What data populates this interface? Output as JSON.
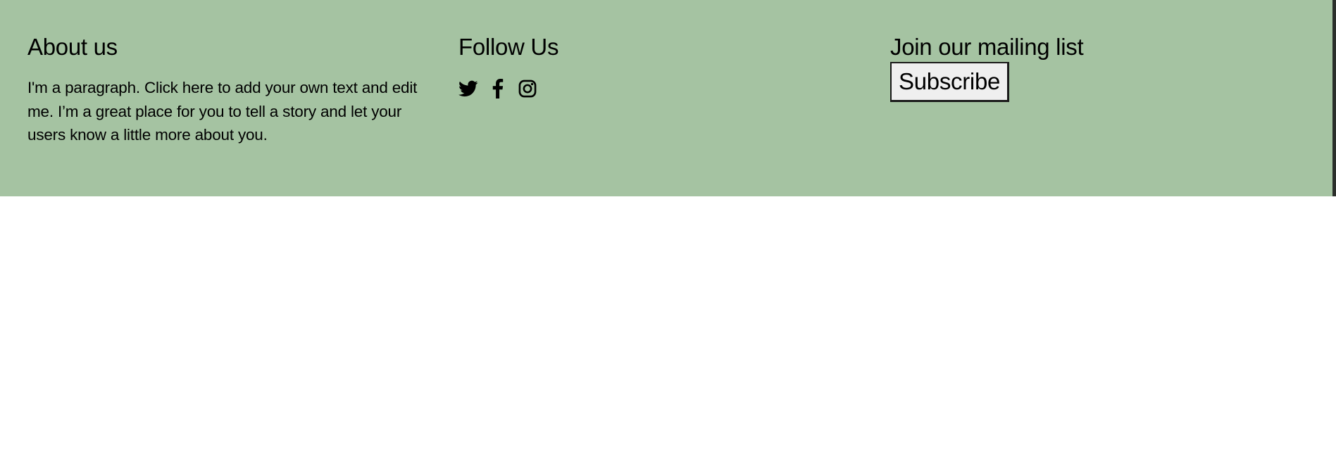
{
  "footer": {
    "background": "#a5c3a2",
    "about": {
      "heading": "About us",
      "paragraph": "I'm a paragraph. Click here to add your own text and edit me. I’m a great place for you to tell a story and let your users know a little more about you."
    },
    "follow": {
      "heading": "Follow Us",
      "icons": [
        "twitter-icon",
        "facebook-icon",
        "instagram-icon"
      ]
    },
    "mailing": {
      "heading": "Join our mailing list",
      "button_label": "Subscribe"
    }
  }
}
